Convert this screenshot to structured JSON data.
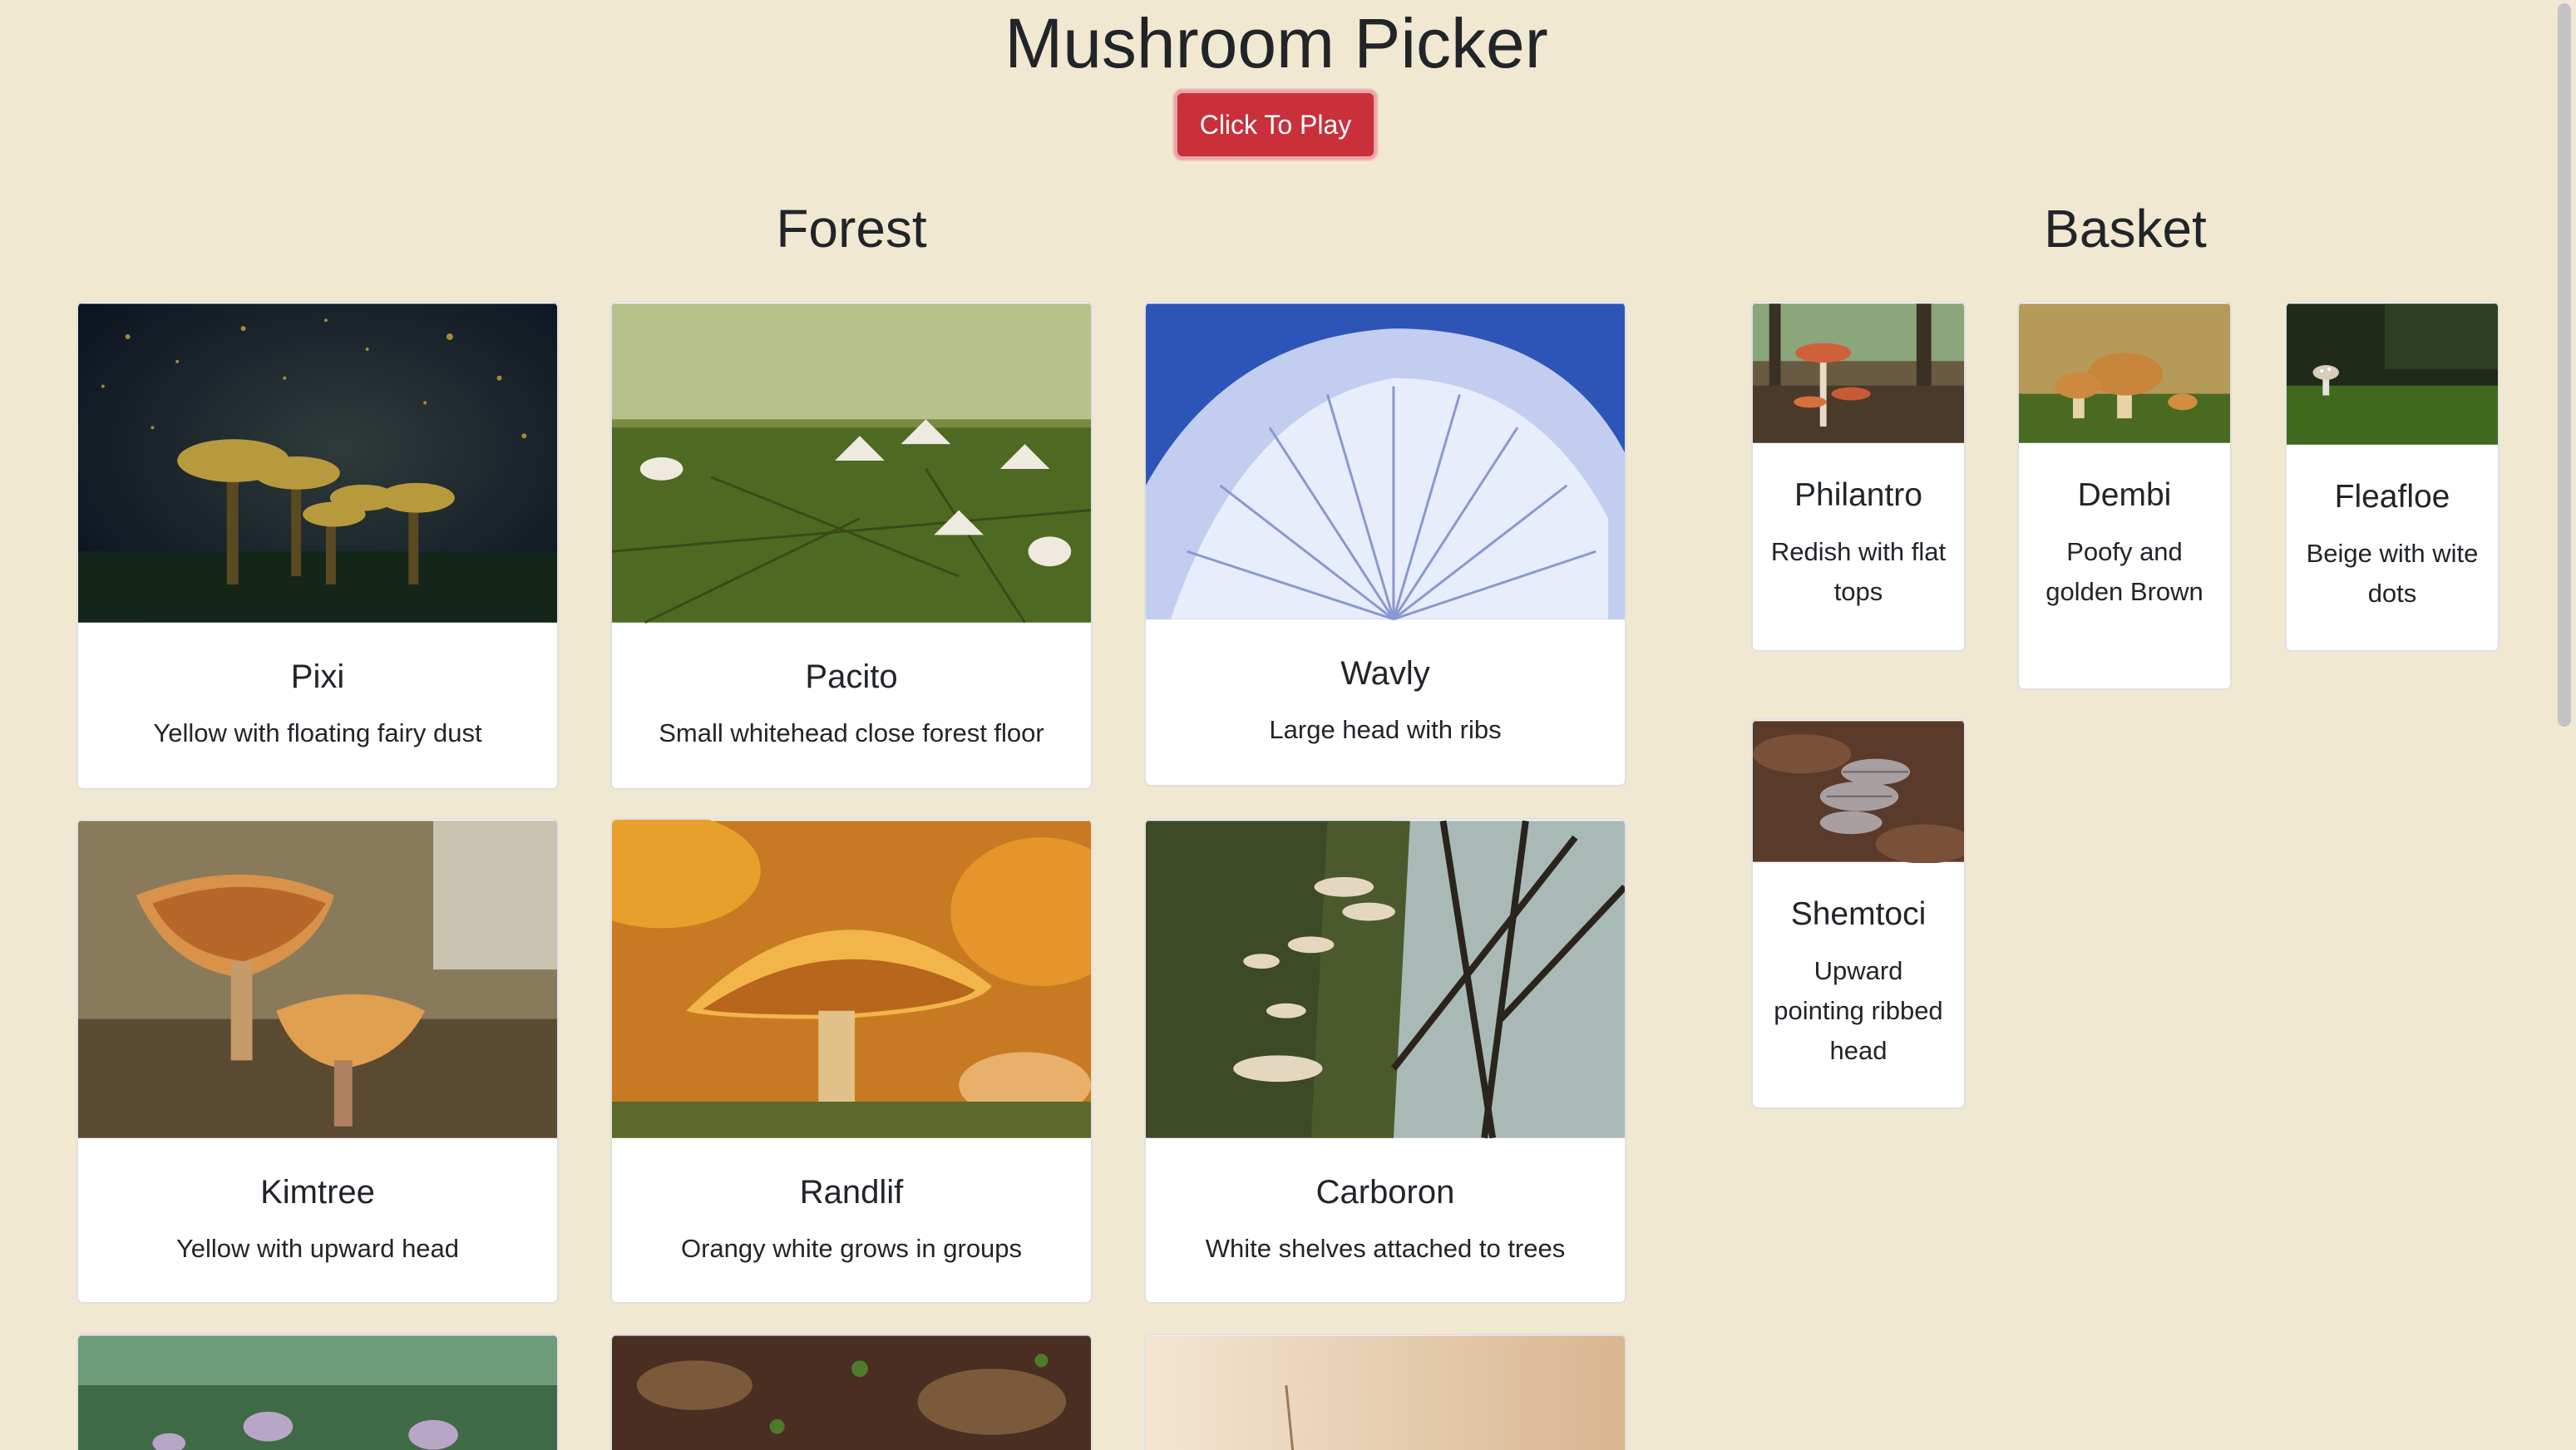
{
  "header": {
    "title": "Mushroom Picker",
    "play_label": "Click To Play"
  },
  "forest": {
    "title": "Forest",
    "cards": [
      {
        "name": "Pixi",
        "desc": "Yellow with floating fairy dust"
      },
      {
        "name": "Pacito",
        "desc": "Small whitehead close forest floor"
      },
      {
        "name": "Wavly",
        "desc": "Large head with ribs"
      },
      {
        "name": "Kimtree",
        "desc": "Yellow with upward head"
      },
      {
        "name": "Randlif",
        "desc": "Orangy white grows in groups"
      },
      {
        "name": "Carboron",
        "desc": "White shelves attached to trees"
      }
    ]
  },
  "basket": {
    "title": "Basket",
    "cards": [
      {
        "name": "Philantro",
        "desc": "Redish with flat tops"
      },
      {
        "name": "Dembi",
        "desc": "Poofy and golden Brown"
      },
      {
        "name": "Fleafloe",
        "desc": "Beige with wite dots"
      },
      {
        "name": "Shemtoci",
        "desc": "Upward pointing ribbed head"
      }
    ]
  }
}
